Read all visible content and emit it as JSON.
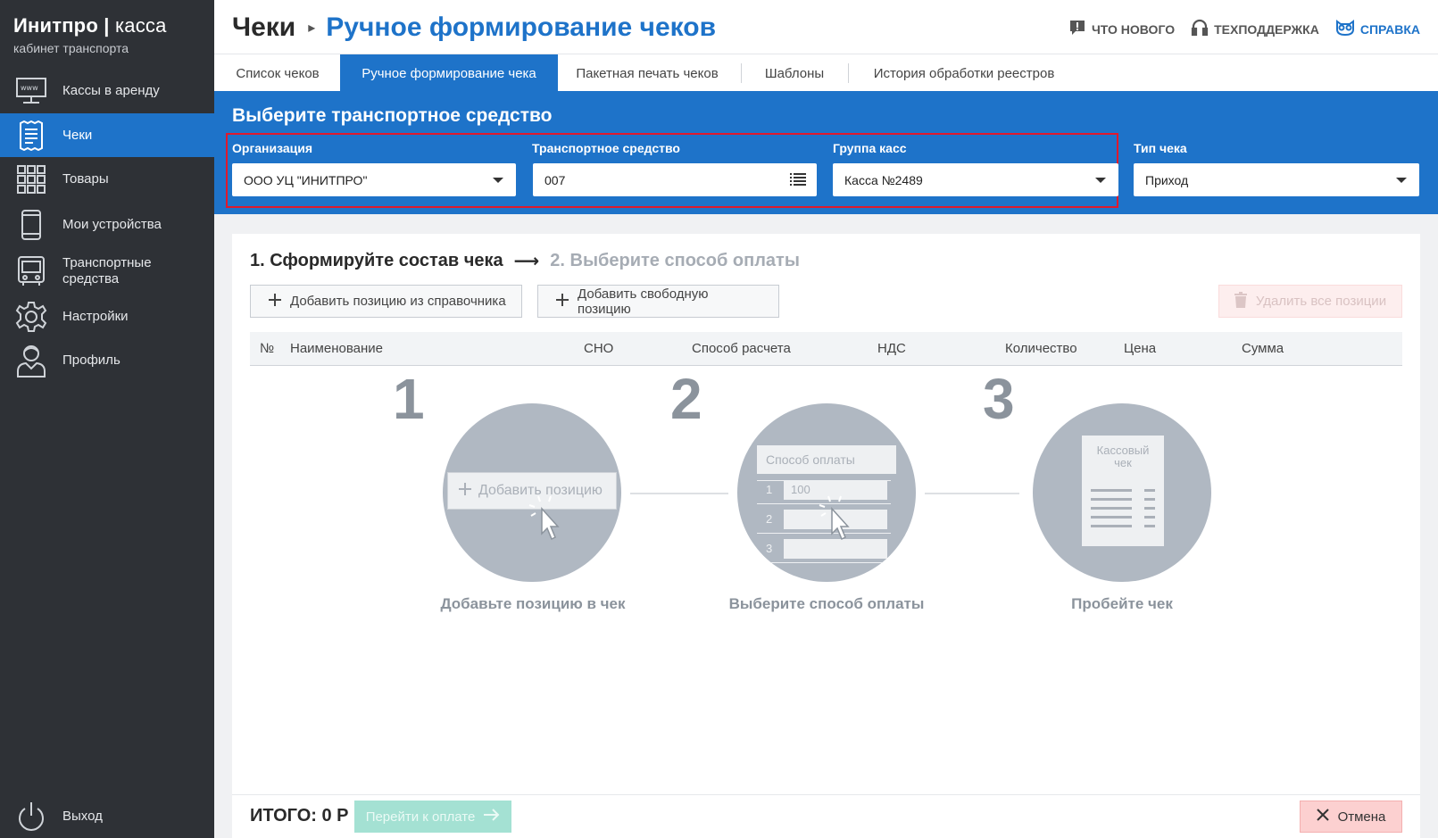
{
  "brand": {
    "name": "Инитпро",
    "name_light": "касса",
    "subtitle": "кабинет транспорта"
  },
  "sidebar": {
    "items": [
      {
        "label": "Кассы в аренду",
        "icon": "www-monitor-icon"
      },
      {
        "label": "Чеки",
        "icon": "receipt-icon",
        "active": true
      },
      {
        "label": "Товары",
        "icon": "grid-icon"
      },
      {
        "label": "Мои устройства",
        "icon": "phone-icon"
      },
      {
        "label": "Транспортные средства",
        "icon": "bus-icon"
      },
      {
        "label": "Настройки",
        "icon": "gear-icon"
      },
      {
        "label": "Профиль",
        "icon": "user-icon"
      }
    ],
    "logout": {
      "label": "Выход",
      "icon": "power-icon"
    }
  },
  "header": {
    "section": "Чеки",
    "page": "Ручное формирование чеков",
    "links": {
      "news": "ЧТО НОВОГО",
      "support": "ТЕХПОДДЕРЖКА",
      "help": "СПРАВКА"
    }
  },
  "tabs": [
    {
      "label": "Список чеков"
    },
    {
      "label": "Ручное формирование чека",
      "active": true
    },
    {
      "label": "Пакетная печать чеков"
    },
    {
      "label": "Шаблоны"
    },
    {
      "label": "История обработки реестров"
    }
  ],
  "vehicle_panel": {
    "title": "Выберите транспортное средство",
    "organization": {
      "label": "Организация",
      "value": "ООО УЦ \"ИНИТПРО\""
    },
    "vehicle": {
      "label": "Транспортное средство",
      "value": "007"
    },
    "register_group": {
      "label": "Группа касс",
      "value": "Касса №2489"
    },
    "receipt_type": {
      "label": "Тип чека",
      "value": "Приход"
    }
  },
  "compose": {
    "step1": "1. Сформируйте состав чека",
    "step2": "2. Выберите способ оплаты",
    "add_from_catalog": "Добавить позицию из справочника",
    "add_free": "Добавить свободную позицию",
    "delete_all": "Удалить все позиции"
  },
  "table": {
    "columns": [
      "№",
      "Наименование",
      "СНО",
      "Способ расчета",
      "НДС",
      "Количество",
      "Цена",
      "Сумма"
    ]
  },
  "illustration": {
    "steps": [
      {
        "number": "1",
        "caption": "Добавьте позицию в чек",
        "inner": "Добавить позицию"
      },
      {
        "number": "2",
        "caption": "Выберите способ оплаты",
        "inner": "Способ оплаты",
        "inner_value": "100",
        "rows": [
          "1",
          "2",
          "3"
        ]
      },
      {
        "number": "3",
        "caption": "Пробейте чек",
        "inner": "Кассовый чек"
      }
    ]
  },
  "footer": {
    "total_label": "ИТОГО: 0 Р",
    "pay_button": "Перейти к оплате",
    "cancel_button": "Отмена"
  },
  "colors": {
    "accent": "#1e73c9",
    "sidebar": "#2e3136",
    "highlight": "#e0192c",
    "pay": "#a4e1d3",
    "cancel": "#fcd0d0"
  }
}
